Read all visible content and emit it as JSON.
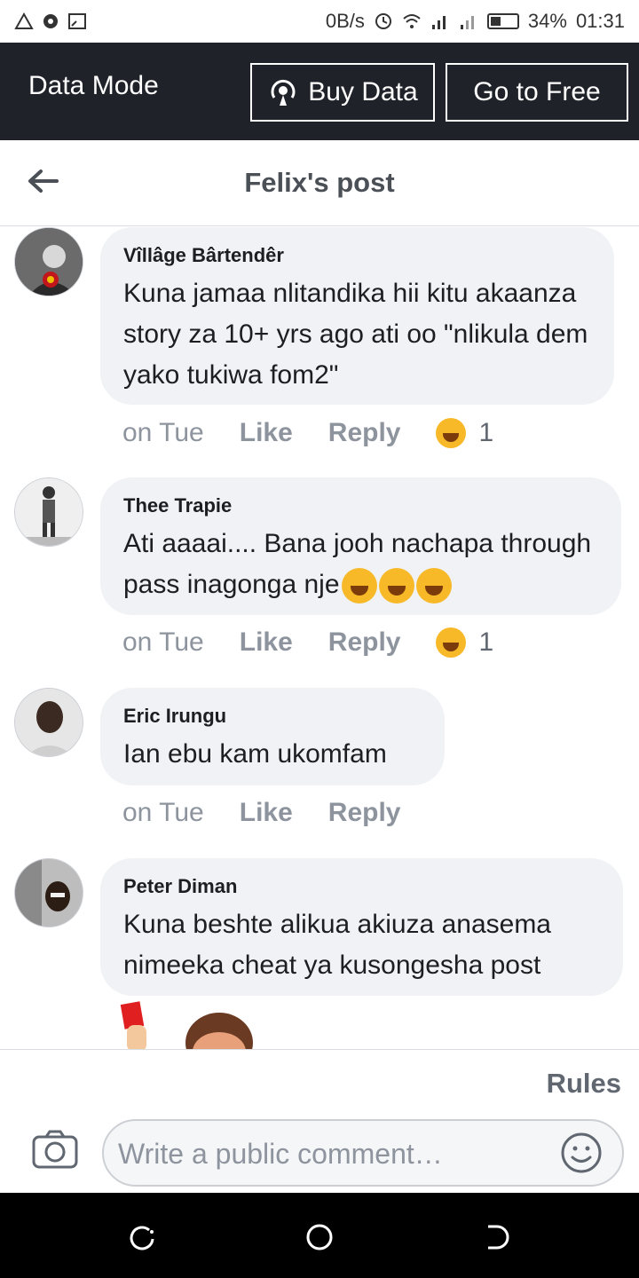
{
  "status_bar": {
    "network_speed": "0B/s",
    "battery": "34%",
    "time": "01:31"
  },
  "data_mode": {
    "title": "Data Mode",
    "buy_label": "Buy Data",
    "free_label": "Go to Free"
  },
  "header": {
    "title": "Felix's post"
  },
  "comments": [
    {
      "author": "Vîllâge Bârtendêr",
      "text": "Kuna jamaa nlitandika hii kitu akaanza story za 10+ yrs ago ati oo \"nlikula dem yako tukiwa fom2\"",
      "time": "on Tue",
      "like": "Like",
      "reply": "Reply",
      "reaction_count": "1"
    },
    {
      "author": "Thee Trapie",
      "text": "Ati aaaai.... Bana jooh nachapa through pass inagonga nje",
      "time": "on Tue",
      "like": "Like",
      "reply": "Reply",
      "reaction_count": "1"
    },
    {
      "author": "Eric Irungu",
      "text": "Ian ebu kam ukomfam",
      "time": "on Tue",
      "like": "Like",
      "reply": "Reply"
    },
    {
      "author": "Peter Diman",
      "text": "Kuna beshte alikua akiuza anasema nimeeka cheat ya kusongesha post"
    }
  ],
  "composer": {
    "rules": "Rules",
    "placeholder": "Write a public comment…"
  },
  "icons": {
    "back": "back-arrow-icon",
    "camera": "camera-icon",
    "emoji": "smiley-icon",
    "reaction": "haha-reaction-icon"
  }
}
